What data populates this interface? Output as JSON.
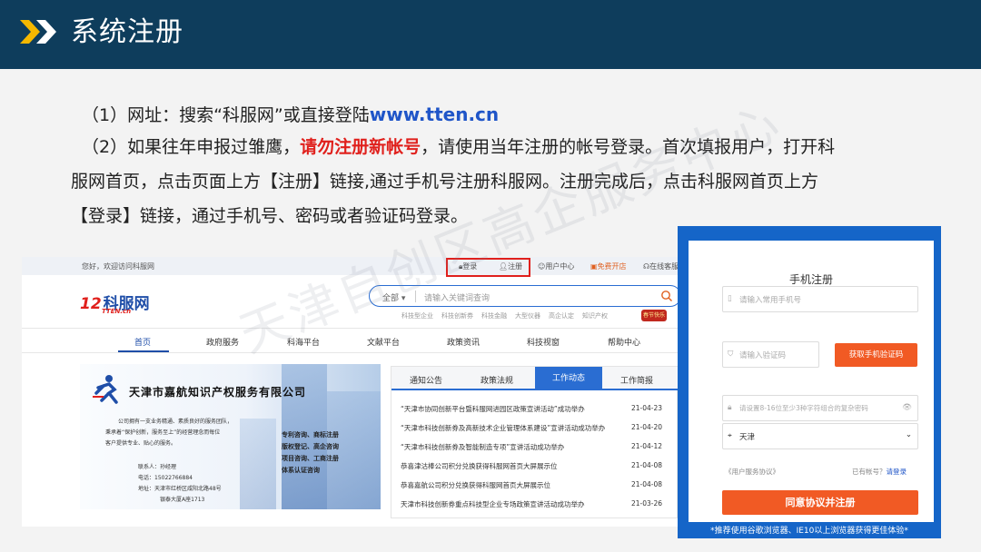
{
  "header": {
    "title": "系统注册"
  },
  "content": {
    "p1_prefix": "（1）网址：搜索“科服网”或直接登陆",
    "p1_url": "www.tten.cn",
    "p2_prefix": "（2）如果往年申报过雏鹰，",
    "p2_red": "请勿注册新帐号",
    "p2_suffix": "，请使用当年注册的帐号登录。首次填报用户，打开科",
    "p3": "服网首页，点击页面上方【注册】链接,通过手机号注册科服网。注册完成后，点击科服网首页上方",
    "p4": "【登录】链接，通过手机号、密码或者验证码登录。"
  },
  "watermark": "天津自创区高企服务中心",
  "site": {
    "welcome": "您好，欢迎访问科服网",
    "login": "登录",
    "register": "注册",
    "user_center": "用户中心",
    "free_shop": "免费开店",
    "online_service": "在线客服",
    "logo_text": "科服网",
    "logo_sub": "TTEN.cn",
    "search_category": "全部",
    "search_placeholder": "请输入关键词查询",
    "hot_keywords": [
      "科技型企业",
      "科技创新券",
      "科技金融",
      "大型仪器",
      "高企认定",
      "知识产权"
    ],
    "badge": "春节快乐",
    "nav": [
      "首页",
      "政府服务",
      "科海平台",
      "文献平台",
      "政策资讯",
      "科技视窗",
      "帮助中心"
    ],
    "banner": {
      "company": "天津市嘉航知识产权服务有限公司",
      "desc1": "公司拥有一支业务精通、素质良好的服务团队，",
      "desc2": "秉承着“保护创新，服务至上”的经营理念而每位",
      "desc3": "客户提供专业、贴心的服务。",
      "contact_name": "联系人：孙经理",
      "phone": "电话：15022766884",
      "addr1": "地址：天津市红桥区咸阳北路48号",
      "addr2": "银泰大厦A座1713",
      "svc1": "专利咨询、商标注册",
      "svc2": "版权登记、高企咨询",
      "svc3": "项目咨询、工商注册",
      "svc4": "体系认证咨询"
    },
    "news_tabs": [
      "通知公告",
      "政策法规",
      "工作动态",
      "工作简报"
    ],
    "news": [
      {
        "title": "“天津市协同创新平台暨科服网进园区政策宣讲活动”成功举办",
        "date": "21-04-23"
      },
      {
        "title": "“天津市科技创新券及高新技术企业管理体系建设”宣讲活动成功举办",
        "date": "21-04-20"
      },
      {
        "title": "“天津市科技创新券及智能制造专项”宣讲活动成功举办",
        "date": "21-04-12"
      },
      {
        "title": "恭喜津沽棒公司积分兑换获得科服网首页大屏展示位",
        "date": "21-04-08"
      },
      {
        "title": "恭喜嘉航公司积分兑换获得科服网首页大屏展示位",
        "date": "21-04-08"
      },
      {
        "title": "天津市科技创新券重点科技型企业专场政策宣讲活动成功举办",
        "date": "21-03-26"
      }
    ]
  },
  "register": {
    "title": "手机注册",
    "phone_placeholder": "请输入常用手机号",
    "code_placeholder": "请输入验证码",
    "get_code": "获取手机验证码",
    "pwd_placeholder": "请设置8-16位至少3种字符组合的复杂密码",
    "city": "天津",
    "protocol": "《用户服务协议》",
    "has_account": "已有帐号？",
    "login_link": "请登录",
    "agree_button": "同意协议并注册",
    "tip": "*推荐使用谷歌浏览器、IE10以上浏览器获得更佳体验*"
  },
  "colors": {
    "header_bg": "#0e3d5c",
    "accent_blue": "#1565c8",
    "accent_orange": "#f15a24",
    "red": "#e0201c"
  }
}
